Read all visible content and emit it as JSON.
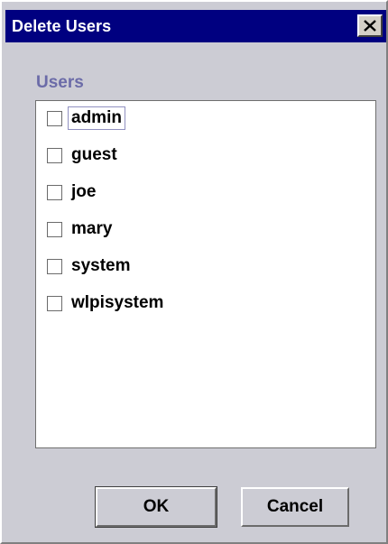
{
  "window": {
    "title": "Delete Users",
    "close_icon": "close-icon"
  },
  "users_group": {
    "label": "Users",
    "items": [
      {
        "label": "admin",
        "checked": false,
        "focused": true
      },
      {
        "label": "guest",
        "checked": false,
        "focused": false
      },
      {
        "label": "joe",
        "checked": false,
        "focused": false
      },
      {
        "label": "mary",
        "checked": false,
        "focused": false
      },
      {
        "label": "system",
        "checked": false,
        "focused": false
      },
      {
        "label": "wlpisystem",
        "checked": false,
        "focused": false
      }
    ]
  },
  "buttons": {
    "ok_label": "OK",
    "cancel_label": "Cancel"
  },
  "colors": {
    "titlebar": "#000080",
    "dialog_bg": "#ccccd4",
    "group_label": "#6b6ba8"
  }
}
